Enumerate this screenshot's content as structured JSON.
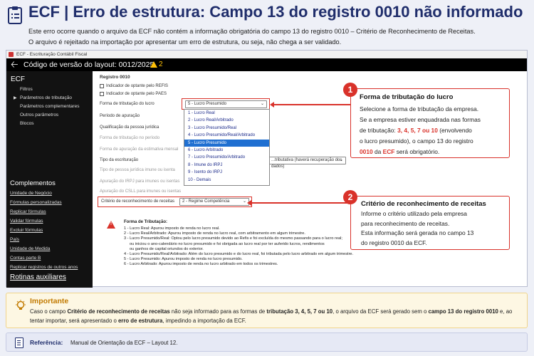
{
  "header": {
    "title": "ECF | Erro de estrutura: Campo 13 do registro 0010 não informado",
    "intro_line1": "Este erro ocorre quando o arquivo da ECF não contém a informação obrigatória do campo 13 do registro 0010 – Critério de Reconhecimento de Receitas.",
    "intro_line2": "O arquivo é rejeitado na importação por apresentar um erro de estrutura, ou seja, não chega a ser validado."
  },
  "window": {
    "title": "ECF - Escrituração Contábil Fiscal",
    "toolbar_text": "Código de versão do layout: 0012/2025",
    "warning_count": "2"
  },
  "sidebar": {
    "heading": "ECF",
    "items": [
      "Filtros",
      "Parâmetros de tributação",
      "Parâmetros complementares",
      "Outros parâmetros",
      "Blocos"
    ],
    "complementos_heading": "Complementos",
    "complementos": [
      "Unidade de Negócio",
      "Fórmulas personalizadas",
      "Replicar fórmulas",
      "Validar fórmulas",
      "Excluir fórmulas",
      "País",
      "Unidade de Medida",
      "Contas parte B",
      "Replicar registros de outros anos"
    ],
    "rotinas": "Rotinas auxiliares"
  },
  "form": {
    "section": "Registro 0010",
    "cb_refis": "Indicador de optante pelo REFIS",
    "cb_paes": "Indicador de optante pelo PAES",
    "forma_label": "Forma de tributação do lucro",
    "forma_value": "5 - Lucro Presumido",
    "periodo_label": "Período de apuração",
    "qualif_label": "Qualificação da pessoa jurídica",
    "forma_periodo_label": "Forma de tributação no período",
    "forma_apur_label": "Forma de apuração da estimativa mensal",
    "tipo_escr_label": "Tipo da escrituração",
    "tipo_escr_value": "...tributativa (haverá recuperação dos dados)",
    "tipo_pj_label": "Tipo de pessoa jurídica imune ou isenta",
    "apur_irpj_label": "Apuração do IRPJ para imunes ou isentas",
    "apur_csll_label": "Apuração do CSLL para imunes ou isentas",
    "criterio_label": "Critério de reconhecimento de receitas",
    "criterio_value": "2 - Regime Competência",
    "dropdown_options": [
      "1 - Lucro Real",
      "2 - Lucro Real/Arbitrado",
      "3 - Lucro Presumido/Real",
      "4 - Lucro Presumido/Real/Arbitrado",
      "5 - Lucro Presumido",
      "6 - Lucro Arbitrado",
      "7 - Lucro Presumido/Arbitrado",
      "8 - Imune do IRPJ",
      "9 - Isento do IRPJ",
      "10 - Demais"
    ]
  },
  "note": {
    "title": "Forma de Tributação:",
    "lines": [
      "1 - Lucro Real: Apurou imposto de renda no lucro real.",
      "2 - Lucro Real/Arbitrado: Apurou imposto de renda no lucro real, com arbitramento em algum trimestre.",
      "3 - Lucro Presumido/Real: Optou pelo lucro presumido devido ao Refis e foi excluída do mesmo passando para o lucro real;",
      "     ou iniciou o ano-calendário no lucro presumido e foi obrigada ao lucro real por ter auferido lucros, rendimentos",
      "     ou ganhos de capital oriundos do exterior.",
      "4 - Lucro Presumido/Real/Arbitrado: Além do lucro presumido e do lucro real, foi tributada pelo lucro arbitrado em algum trimestre.",
      "5 - Lucro Presumido: Apurou imposto de renda no lucro presumido.",
      "6 - Lucro Arbitrado: Apurou imposto de renda no lucro arbitrado em todos os trimestres."
    ]
  },
  "callout1": {
    "number": "1",
    "title": "Forma de tributação do lucro",
    "l1": "Selecione a forma de tributação da empresa.",
    "l2": "Se a empresa estiver enquadrada nas formas",
    "l3_pre": "de tributação: ",
    "l3_red": "3, 4, 5, 7 ou 10",
    "l3_post": " (envolvendo",
    "l4": "o lucro presumido), o campo 13 do registro",
    "l5_a": "0010",
    "l5_b": " da ",
    "l5_c": "ECF",
    "l5_d": " será obrigatório."
  },
  "callout2": {
    "number": "2",
    "title": "Critério de reconhecimento de receitas",
    "l1": "Informe o critério utilizado pela empresa",
    "l2": "para reconhecimento de receitas.",
    "l3": "Esta informação será gerada no campo 13",
    "l4": "do registro 0010 da ECF."
  },
  "importante": {
    "heading": "Importante",
    "p1": "Caso o campo ",
    "b1": "Critério de reconhecimento de receitas",
    "p2": " não seja informado para as formas de ",
    "b2": "tributação 3, 4, 5, 7 ou 10",
    "p3": ", o arquivo da ECF será gerado sem o ",
    "b3": "campo 13 do registro 0010",
    "p4": " e, ao tentar importar, será apresentado o ",
    "b4": "erro de estrutura",
    "p5": ", impedindo a importação da ECF."
  },
  "referencia": {
    "label": "Referência:",
    "value": "Manual de Orientação da ECF – Layout 12."
  },
  "colors": {
    "navy": "#1f2d6b",
    "red": "#d9322a",
    "amber": "#c27a00",
    "selected": "#1f6fd1"
  }
}
